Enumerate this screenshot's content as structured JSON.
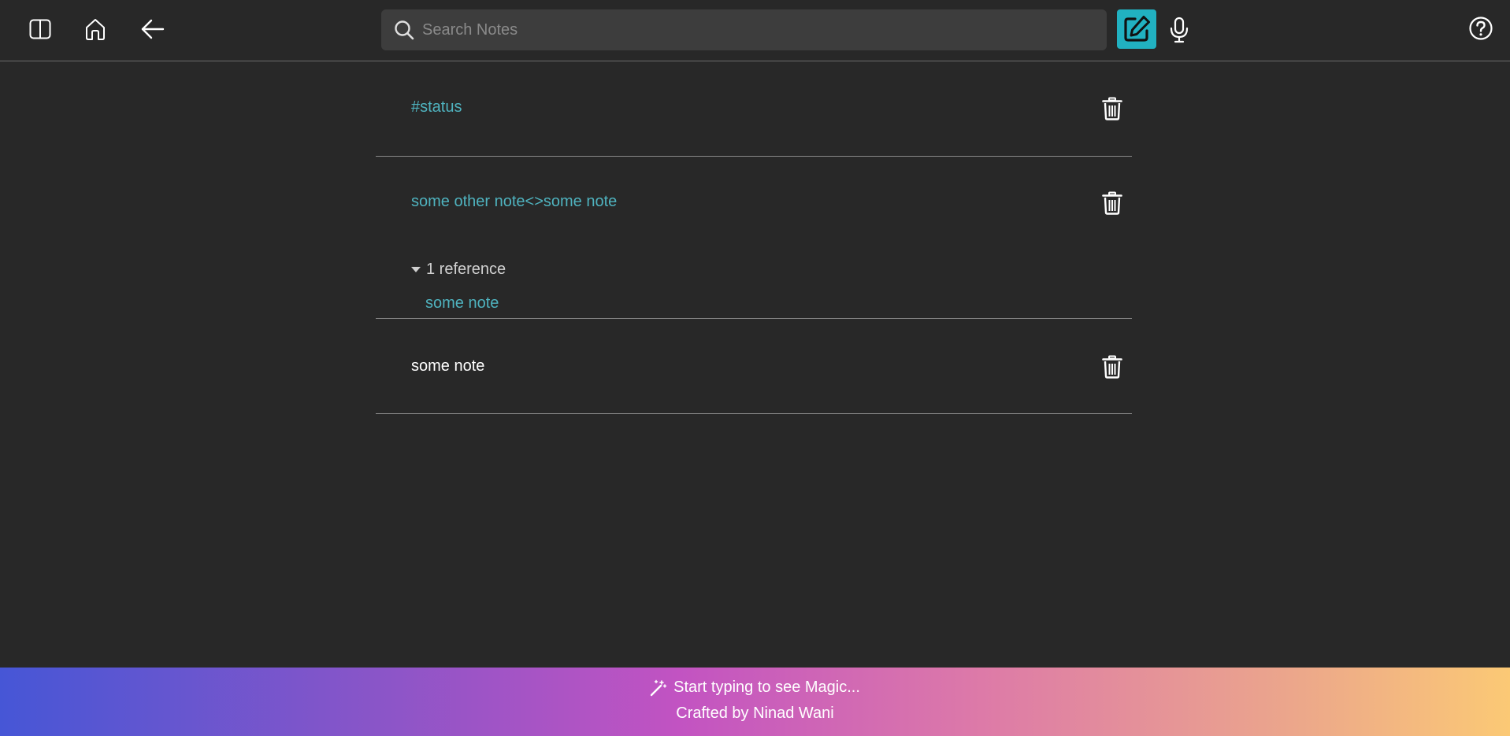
{
  "topbar": {
    "left_icons": [
      "sidebar-toggle-icon",
      "home-icon",
      "back-arrow-icon"
    ],
    "search": {
      "placeholder": "Search Notes",
      "value": ""
    },
    "right_icons": [
      "new-note-icon",
      "microphone-icon",
      "help-icon"
    ]
  },
  "notes": [
    {
      "title": "#status",
      "style": "link"
    },
    {
      "title": "some other note<>some note",
      "style": "link",
      "references": {
        "toggle_label": "1 reference",
        "items": [
          "some note"
        ]
      }
    },
    {
      "title": "some note",
      "style": "plain"
    }
  ],
  "footer": {
    "magic_text": "Start typing to see Magic...",
    "credit_text": "Crafted by Ninad Wani"
  },
  "colors": {
    "background": "#282828",
    "accent": "#21b1c1",
    "link": "#4fb3bf",
    "divider": "#8a8a8a"
  }
}
